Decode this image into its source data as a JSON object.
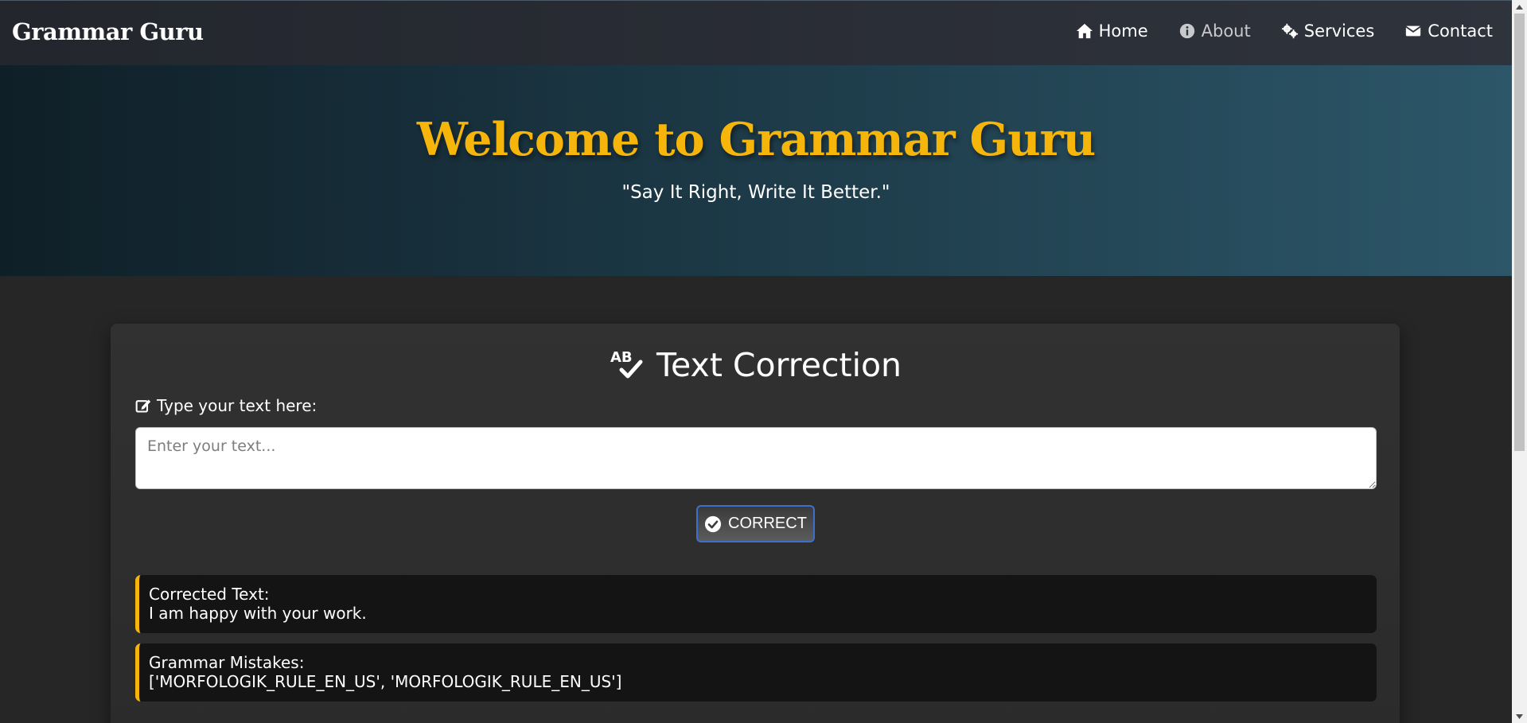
{
  "navbar": {
    "brand": "Grammar Guru",
    "links": [
      {
        "label": "Home",
        "icon": "home-icon"
      },
      {
        "label": "About",
        "icon": "info-icon"
      },
      {
        "label": "Services",
        "icon": "gears-icon"
      },
      {
        "label": "Contact",
        "icon": "envelope-icon"
      }
    ]
  },
  "hero": {
    "title": "Welcome to Grammar Guru",
    "subtitle": "\"Say It Right, Write It Better.\""
  },
  "correction": {
    "title": "Text Correction",
    "title_icon": "spell-check-icon",
    "input_label": "Type your text here:",
    "input_label_icon": "edit-icon",
    "input_placeholder": "Enter your text...",
    "input_value": "",
    "button_label": "CORRECT",
    "button_icon": "check-circle-icon",
    "results": [
      {
        "heading": "Corrected Text:",
        "value": "I am happy with your work."
      },
      {
        "heading": "Grammar Mistakes:",
        "value": "['MORFOLOGIK_RULE_EN_US', 'MORFOLOGIK_RULE_EN_US']"
      }
    ]
  },
  "colors": {
    "accent": "#f5b50b",
    "navbar": "#2a2d34",
    "page_background": "#262626",
    "button_border": "#3d6fd0"
  }
}
